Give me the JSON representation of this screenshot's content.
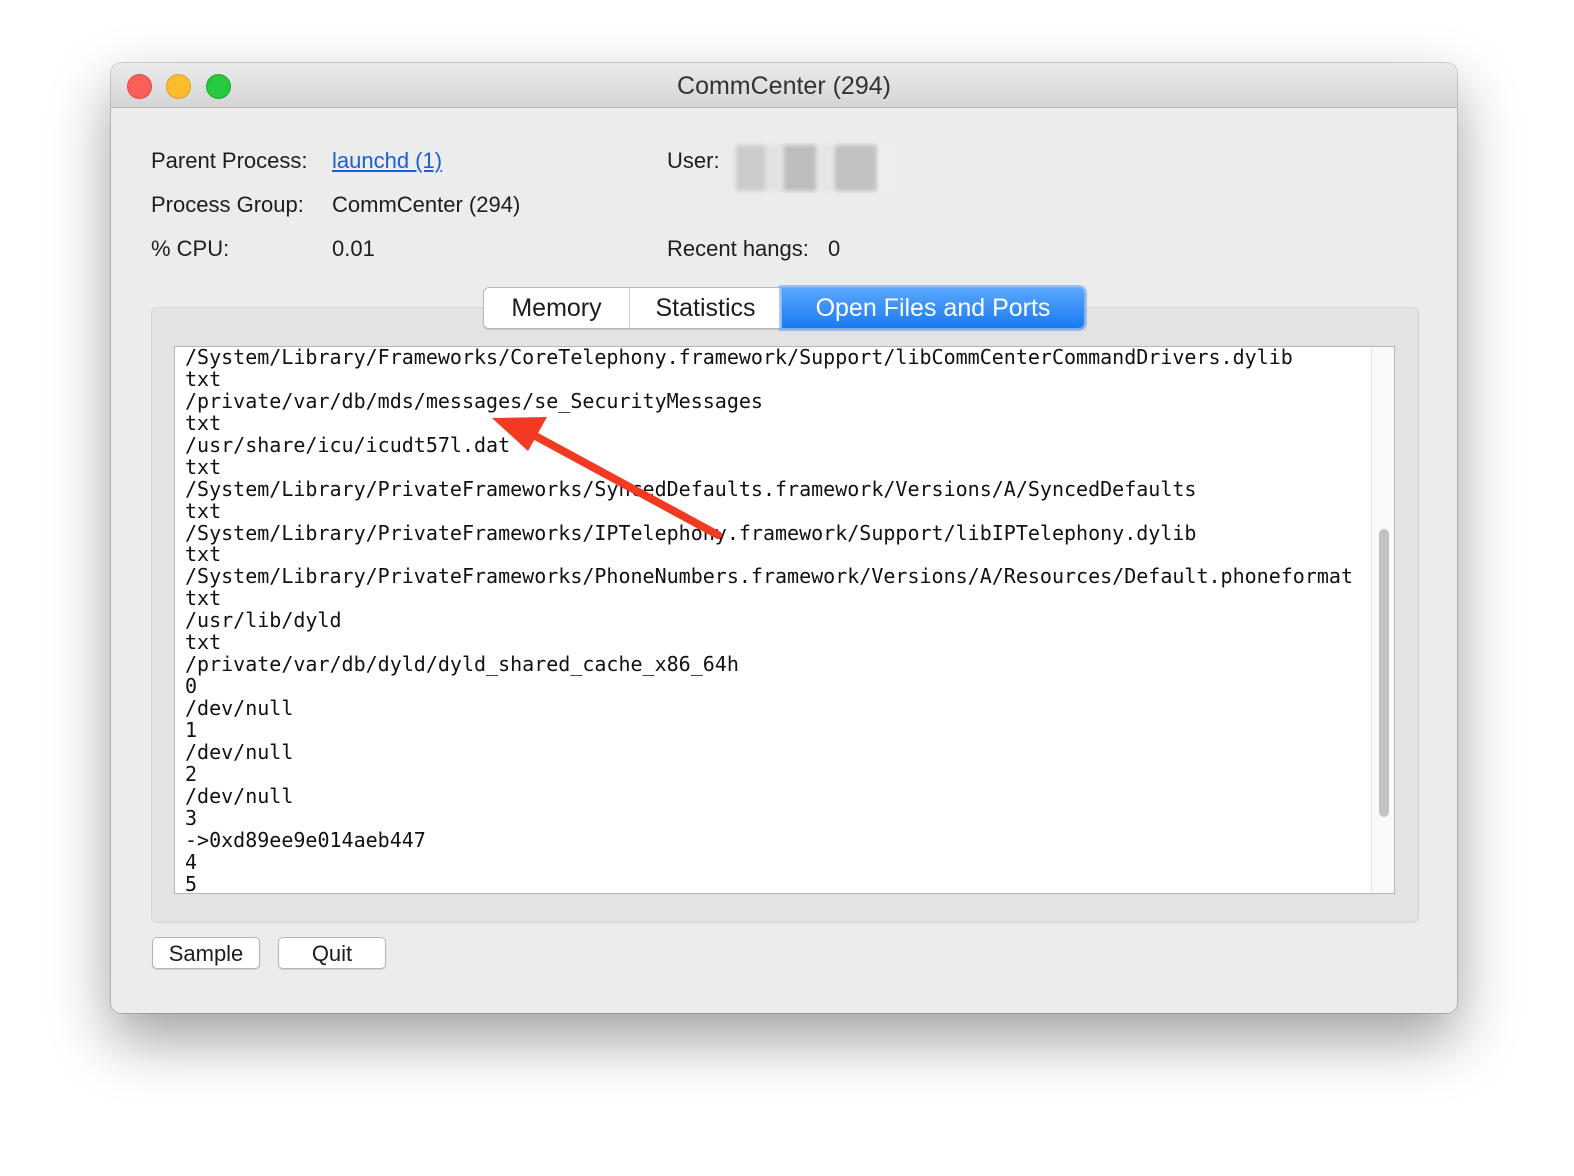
{
  "window": {
    "title": "CommCenter (294)"
  },
  "info": {
    "parent_process_label": "Parent Process:",
    "parent_process_value": "launchd (1)",
    "process_group_label": "Process Group:",
    "process_group_value": "CommCenter (294)",
    "cpu_label": "% CPU:",
    "cpu_value": "0.01",
    "user_label": "User:",
    "recent_hangs_label": "Recent hangs:",
    "recent_hangs_value": "0"
  },
  "tabs": [
    {
      "label": "Memory",
      "selected": false
    },
    {
      "label": "Statistics",
      "selected": false
    },
    {
      "label": "Open Files and Ports",
      "selected": true
    }
  ],
  "open_files": [
    "/System/Library/Frameworks/CoreTelephony.framework/Support/libCommCenterCommandDrivers.dylib",
    "txt",
    "/private/var/db/mds/messages/se_SecurityMessages",
    "txt",
    "/usr/share/icu/icudt57l.dat",
    "txt",
    "/System/Library/PrivateFrameworks/SyncedDefaults.framework/Versions/A/SyncedDefaults",
    "txt",
    "/System/Library/PrivateFrameworks/IPTelephony.framework/Support/libIPTelephony.dylib",
    "txt",
    "/System/Library/PrivateFrameworks/PhoneNumbers.framework/Versions/A/Resources/Default.phoneformat",
    "txt",
    "/usr/lib/dyld",
    "txt",
    "/private/var/db/dyld/dyld_shared_cache_x86_64h",
    "0",
    "/dev/null",
    "1",
    "/dev/null",
    "2",
    "/dev/null",
    "3",
    "->0xd89ee9e014aeb447",
    "4",
    "5"
  ],
  "buttons": {
    "sample": "Sample",
    "quit": "Quit"
  },
  "annotation": {
    "arrow_color": "#f23a23"
  }
}
